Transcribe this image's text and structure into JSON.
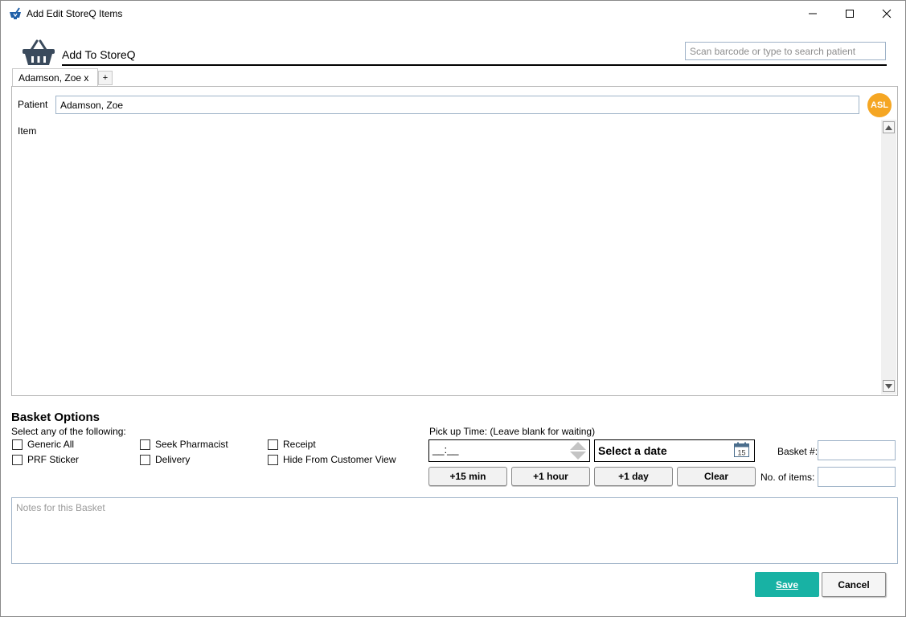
{
  "window": {
    "title": "Add Edit StoreQ Items"
  },
  "header": {
    "title": "Add To StoreQ",
    "search_placeholder": "Scan barcode or type to search patient"
  },
  "tabs": [
    {
      "label": "Adamson, Zoe x"
    }
  ],
  "tab_add_label": "+",
  "patient": {
    "label": "Patient",
    "value": "Adamson, Zoe",
    "badge": "ASL",
    "badge_color": "#f5a623"
  },
  "item": {
    "label": "Item"
  },
  "basket_options": {
    "title": "Basket Options",
    "instruction": "Select any of the following:",
    "checkboxes": [
      {
        "label": "Generic All",
        "checked": false
      },
      {
        "label": "Seek Pharmacist",
        "checked": false
      },
      {
        "label": "Receipt",
        "checked": false
      },
      {
        "label": "PRF Sticker",
        "checked": false
      },
      {
        "label": "Delivery",
        "checked": false
      },
      {
        "label": "Hide From Customer View",
        "checked": false
      }
    ]
  },
  "pickup": {
    "label": "Pick up Time: (Leave blank for waiting)",
    "time_value": "__:__",
    "date_placeholder": "Select a date",
    "calendar_day": "15",
    "quick_buttons": [
      "+15 min",
      "+1 hour",
      "+1 day",
      "Clear"
    ]
  },
  "basket_number": {
    "label": "Basket #:",
    "value": ""
  },
  "num_items": {
    "label": "No. of items:",
    "value": ""
  },
  "notes": {
    "placeholder": "Notes for this Basket"
  },
  "footer": {
    "save_label": "Save",
    "cancel_label": "Cancel",
    "save_color": "#18b2a4"
  }
}
